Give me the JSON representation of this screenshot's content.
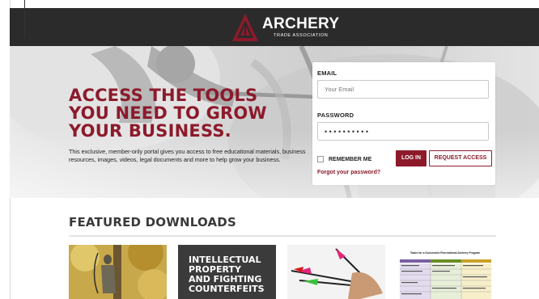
{
  "brand": {
    "name": "ARCHERY",
    "sub": "TRADE ASSOCIATION",
    "accent": "#8c1a2b",
    "header_bg": "#2b2b2b"
  },
  "hero": {
    "headline": [
      "ACCESS THE TOOLS",
      "YOU NEED TO GROW",
      "YOUR BUSINESS."
    ],
    "intro": "This exclusive, member-only portal gives you access to free educational materials, business resources, images, videos, legal documents and more to help grow your business."
  },
  "login": {
    "email_label": "EMAIL",
    "email_placeholder": "Your Email",
    "password_label": "PASSWORD",
    "password_value": "••••••••••",
    "remember_label": "REMEMBER ME",
    "login_button": "LOG IN",
    "request_button": "REQUEST ACCESS",
    "forgot_link": "Forgot your password?"
  },
  "featured": {
    "title": "FEATURED DOWNLOADS",
    "items": [
      {
        "kind": "photo",
        "subject": "bowhunter-in-tree"
      },
      {
        "kind": "title-card",
        "title_lines": [
          "INTELLECTUAL",
          "PROPERTY",
          "AND FIGHTING",
          "COUNTERFEITS"
        ]
      },
      {
        "kind": "photo",
        "subject": "arrows-in-hand"
      },
      {
        "kind": "document",
        "doc_title": "Tasks for a Successful Recreational Archery Program"
      }
    ]
  }
}
